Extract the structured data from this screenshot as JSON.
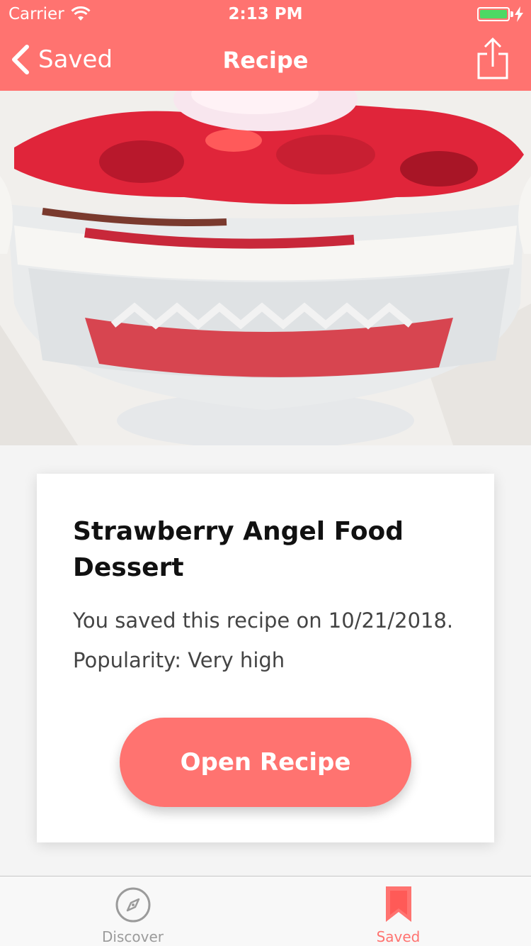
{
  "status_bar": {
    "carrier": "Carrier",
    "time": "2:13 PM",
    "wifi_icon": "wifi-icon",
    "battery_icon": "battery-icon",
    "battery_color": "#4cd964"
  },
  "nav": {
    "back_label": "Saved",
    "title": "Recipe",
    "back_icon": "chevron-left-icon",
    "share_icon": "share-icon",
    "color": "#ff7370"
  },
  "hero": {
    "image": "strawberry-trifle-photo"
  },
  "card": {
    "title": "Strawberry Angel Food Dessert",
    "saved_text": "You saved this recipe on 10/21/2018.",
    "popularity_text": "Popularity: Very high",
    "button_label": "Open Recipe"
  },
  "tab_bar": {
    "tabs": [
      {
        "label": "Discover",
        "icon": "compass-icon",
        "selected": false
      },
      {
        "label": "Saved",
        "icon": "bookmark-icon",
        "selected": true
      }
    ],
    "active_color": "#ff7370",
    "inactive_color": "#9b9b9b"
  }
}
